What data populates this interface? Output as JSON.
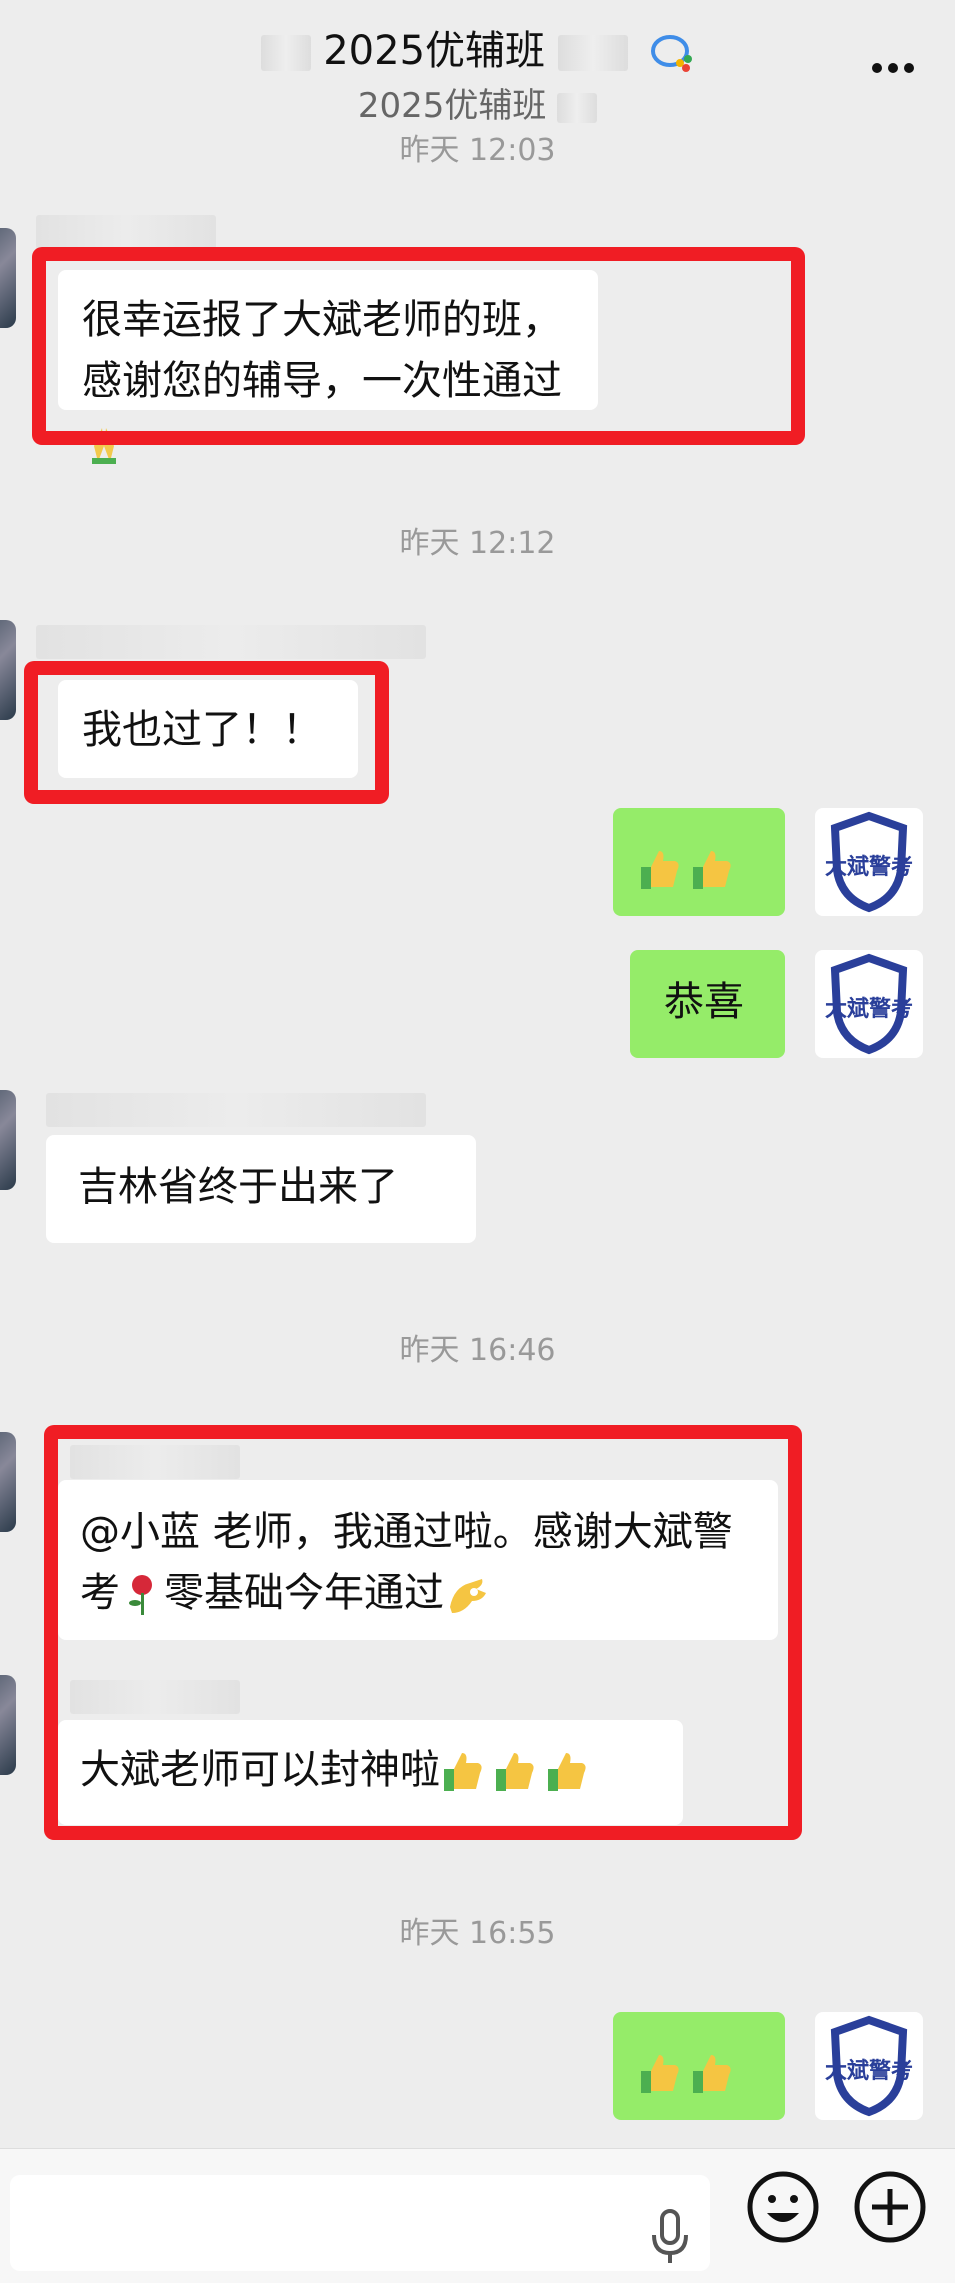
{
  "header": {
    "title": "2025优辅班",
    "subtitle": "2025优辅班"
  },
  "timestamps": [
    "昨天 12:03",
    "昨天 12:12",
    "昨天 16:46",
    "昨天 16:55"
  ],
  "messages": {
    "m1": "很幸运报了大斌老师的班，感谢您的辅导，一次性通过",
    "m2": "我也过了！！",
    "m4": "恭喜",
    "m5": "吉林省终于出来了",
    "m6a": "@小蓝  老师，我通过啦。感谢大斌警考",
    "m6b": "零基础今年通过",
    "m7": "大斌老师可以封神啦"
  },
  "brand": {
    "avatar_text": "大斌警考",
    "accent_color": "#2a3f9a"
  },
  "colors": {
    "highlight_border": "#f01d24",
    "own_bubble": "#95ec69",
    "other_bubble": "#ffffff"
  },
  "icons": {
    "more": "more-icon",
    "mic": "microphone-icon",
    "emoji": "emoji-icon",
    "plus": "plus-icon"
  }
}
